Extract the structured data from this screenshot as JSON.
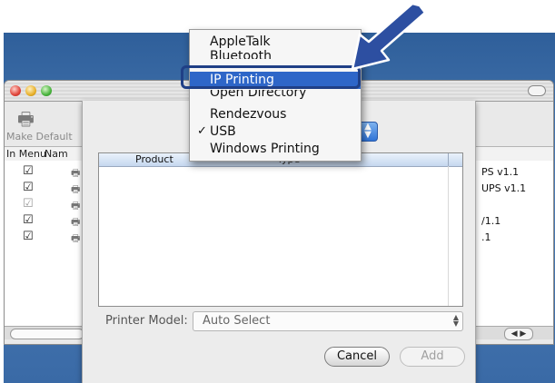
{
  "background_window": {
    "toolbar": {
      "make_default_label": "Make Default"
    },
    "columns": {
      "in_menu": "In Menu",
      "name": "Nam"
    },
    "rows": [
      {
        "checked": true,
        "enabled": true,
        "right_text": "PS v1.1"
      },
      {
        "checked": true,
        "enabled": true,
        "right_text": "UPS v1.1"
      },
      {
        "checked": true,
        "enabled": false,
        "right_text": ""
      },
      {
        "checked": true,
        "enabled": true,
        "right_text": "/1.1"
      },
      {
        "checked": true,
        "enabled": true,
        "right_text": ".1"
      }
    ]
  },
  "popup_menu": {
    "items": [
      {
        "label": "AppleTalk",
        "checked": false,
        "highlighted": false
      },
      {
        "label": "Bluetooth",
        "checked": false,
        "highlighted": false
      },
      {
        "label": "IP Printing",
        "checked": false,
        "highlighted": true
      },
      {
        "label": "Open Directory",
        "checked": false,
        "highlighted": false
      },
      {
        "label": "Rendezvous",
        "checked": false,
        "highlighted": false
      },
      {
        "label": "USB",
        "checked": true,
        "highlighted": false
      },
      {
        "label": "Windows Printing",
        "checked": false,
        "highlighted": false
      }
    ],
    "checkmark": "✓"
  },
  "sheet": {
    "list_columns": {
      "product": "Product",
      "type": "Type"
    },
    "printer_model_label": "Printer Model:",
    "printer_model_value": "Auto Select",
    "cancel_label": "Cancel",
    "add_label": "Add"
  },
  "icons": {
    "checkbox": "☑",
    "printer": "🖶"
  },
  "colors": {
    "highlight": "#2e66c8",
    "arrow": "#2d4fa1",
    "desktop": "#3a6aa6"
  }
}
